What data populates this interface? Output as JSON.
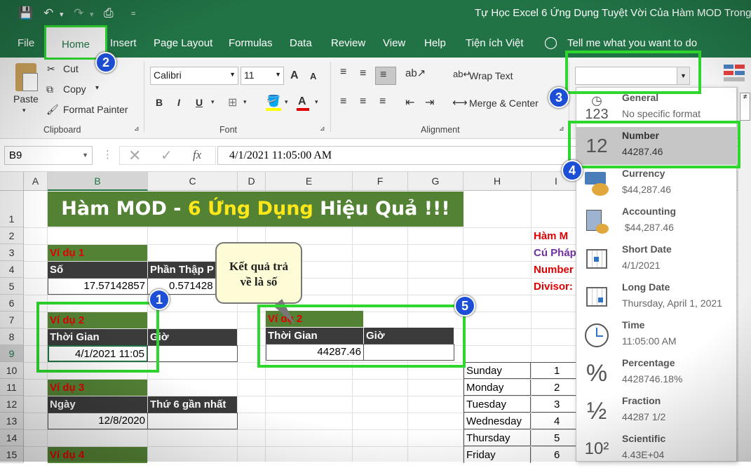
{
  "titlebar": {
    "title": "Tự Học Excel 6 Ứng Dụng Tuyệt Vời Của Hàm MOD Trong E"
  },
  "menu": {
    "file": "File",
    "home": "Home",
    "insert": "Insert",
    "page_layout": "Page Layout",
    "formulas": "Formulas",
    "data": "Data",
    "review": "Review",
    "view": "View",
    "help": "Help",
    "tien_ich": "Tiện ích Việt",
    "tell_me": "Tell me what you want to do"
  },
  "ribbon": {
    "paste": "Paste",
    "cut": "Cut",
    "copy": "Copy",
    "format_painter": "Format Painter",
    "clipboard_label": "Clipboard",
    "font_name": "Calibri",
    "font_size": "11",
    "font_label": "Font",
    "wrap_text": "Wrap Text",
    "merge_center": "Merge & Center",
    "alignment_label": "Alignment",
    "number_format_value": "",
    "bold": "B",
    "italic": "I",
    "underline": "U",
    "grow": "A",
    "shrink": "A",
    "font_color": "A"
  },
  "formula_bar": {
    "name_box": "B9",
    "fx": "fx",
    "content": "4/1/2021  11:05:00 AM"
  },
  "columns": [
    "A",
    "B",
    "C",
    "D",
    "E",
    "F",
    "G",
    "H",
    "I"
  ],
  "rows": [
    "1",
    "2",
    "3",
    "4",
    "5",
    "6",
    "7",
    "8",
    "9",
    "10",
    "11",
    "12",
    "13",
    "14",
    "15"
  ],
  "sheet": {
    "title_part1": "Hàm MOD - ",
    "title_part2": "6 Ứng Dụng",
    "title_part3": " Hiệu Quả !!!",
    "vd1": "Ví dụ 1",
    "so": "Số",
    "phan_thap_phan": "Phần Thập P",
    "b5": "17.57142857",
    "c5": "0.571428",
    "vd2": "Ví dụ 2",
    "thoi_gian": "Thời Gian",
    "gio": "Giờ",
    "b9": "4/1/2021 11:05",
    "vd3": "Ví dụ 3",
    "ngay": "Ngày",
    "thu6": "Thứ 6 gần nhất",
    "b13": "12/8/2020",
    "vd4": "Ví dụ 4",
    "e7": "Ví dụ 2",
    "e8": "Thời Gian",
    "f8": "Giờ",
    "e9": "44287.46",
    "i2": "Hàm M",
    "i3": "Cú Pháp",
    "i4": "Number",
    "i5": "Divisor:",
    "days": [
      "Sunday",
      "Monday",
      "Tuesday",
      "Wednesday",
      "Thursday",
      "Friday"
    ],
    "day_nums": [
      "1",
      "2",
      "3",
      "4",
      "5",
      "6"
    ]
  },
  "callout": {
    "line1": "Kết quả trả",
    "line2": "về là số"
  },
  "dropdown": [
    {
      "name": "General",
      "sample": "No specific format",
      "icon": "clock-123-icon"
    },
    {
      "name": "Number",
      "sample": "44287.46",
      "icon": "number-12-icon",
      "glyph": "12"
    },
    {
      "name": "Currency",
      "sample": "$44,287.46",
      "icon": "currency-icon"
    },
    {
      "name": "Accounting",
      "sample": " $44,287.46",
      "icon": "accounting-icon"
    },
    {
      "name": "Short Date",
      "sample": "4/1/2021",
      "icon": "calendar-icon"
    },
    {
      "name": "Long Date",
      "sample": "Thursday, April 1, 2021",
      "icon": "calendar-icon"
    },
    {
      "name": "Time",
      "sample": "11:05:00 AM",
      "icon": "clock-icon"
    },
    {
      "name": "Percentage",
      "sample": "4428746.18%",
      "icon": "percent-icon",
      "glyph": "%"
    },
    {
      "name": "Fraction",
      "sample": "44287 1/2",
      "icon": "fraction-icon",
      "glyph": "½"
    },
    {
      "name": "Scientific",
      "sample": "4.43E+04",
      "icon": "scientific-icon",
      "glyph": "10²"
    }
  ],
  "badges": [
    "1",
    "2",
    "3",
    "4",
    "5"
  ],
  "colors": {
    "excel_green": "#217346",
    "highlight": "#2ed62e",
    "badge_blue": "#1d4fd6",
    "band_green": "#548235"
  }
}
